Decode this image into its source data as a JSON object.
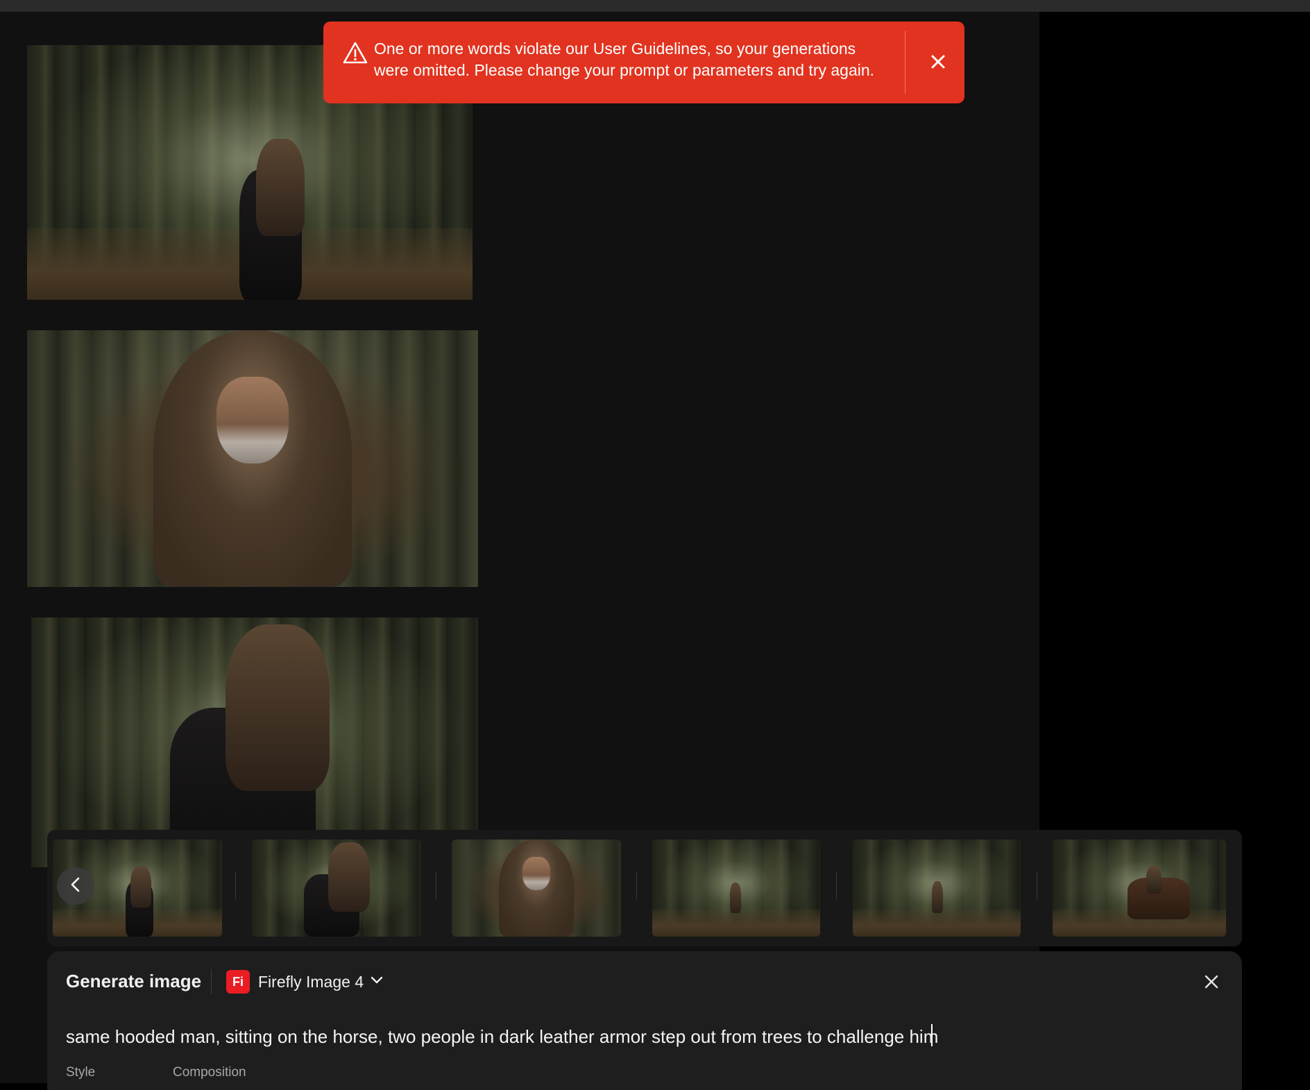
{
  "toast": {
    "message": "One or more words violate our User Guidelines, so your generations were omitted. Please change your prompt or parameters and try again.",
    "icon": "warning-triangle-icon",
    "close_icon": "close-icon",
    "color": "#e1331f"
  },
  "gallery": {
    "images": [
      {
        "name": "hooded-rider-forest-path"
      },
      {
        "name": "hooded-man-portrait"
      },
      {
        "name": "hooded-rider-closeup"
      }
    ]
  },
  "strip": {
    "prev_icon": "chevron-left-icon",
    "thumbnails": [
      {
        "name": "thumb-rider-path"
      },
      {
        "name": "thumb-rider-closeup"
      },
      {
        "name": "thumb-portrait"
      },
      {
        "name": "thumb-rider-distant"
      },
      {
        "name": "thumb-rider-distant-2"
      },
      {
        "name": "thumb-riders-group"
      }
    ]
  },
  "panel": {
    "title": "Generate image",
    "model_badge": "Fi",
    "model_label": "Firefly Image 4",
    "model_color": "#eb1c24",
    "prompt_value": "same hooded man, sitting on the horse, two people in dark leather armor step out from trees to challenge him",
    "style_label": "Style",
    "composition_label": "Composition"
  }
}
